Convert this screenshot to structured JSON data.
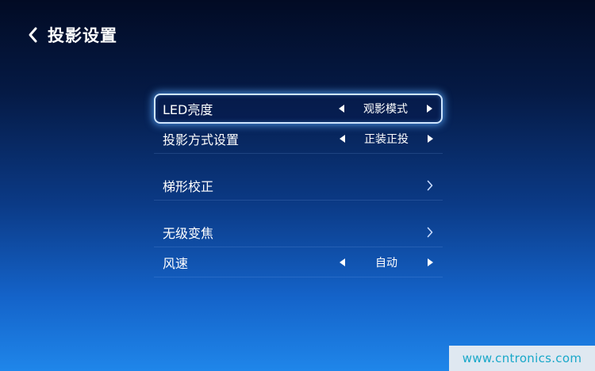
{
  "header": {
    "back_icon": "chevron-left-icon",
    "title": "投影设置"
  },
  "menu": {
    "items": [
      {
        "label": "LED亮度",
        "value": "观影模式",
        "type": "selector",
        "selected": true
      },
      {
        "label": "投影方式设置",
        "value": "正装正投",
        "type": "selector",
        "selected": false
      },
      {
        "label": "梯形校正",
        "type": "submenu",
        "icon": "chevron-right-icon"
      },
      {
        "label": "无级变焦",
        "type": "submenu",
        "icon": "chevron-right-icon"
      },
      {
        "label": "风速",
        "value": "自动",
        "type": "selector",
        "selected": false
      }
    ]
  },
  "watermark": {
    "text": "www.cntronics.com"
  },
  "colors": {
    "text": "#ffffff",
    "focus_border": "#cfe6ff",
    "focus_glow": "#5aaaff",
    "watermark_text": "#19a8c9",
    "watermark_bg": "#dfe8f1"
  }
}
